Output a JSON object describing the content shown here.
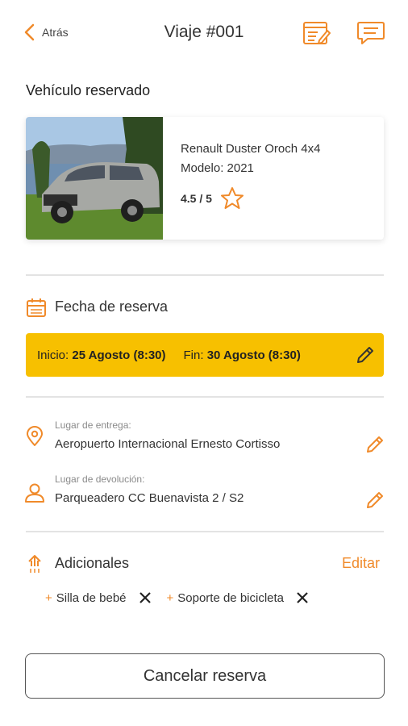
{
  "header": {
    "back_label": "Atrás",
    "title": "Viaje #001",
    "icons": [
      "notes-icon",
      "chat-icon"
    ]
  },
  "vehicle": {
    "section_title": "Vehículo reservado",
    "name": "Renault Duster Oroch 4x4",
    "model": "Modelo: 2021",
    "rating": "4.5 / 5"
  },
  "booking_dates": {
    "title": "Fecha de reserva",
    "start_label": "Inicio:",
    "start_value": "25 Agosto (8:30)",
    "end_label": "Fin:",
    "end_value": "30 Agosto (8:30)"
  },
  "pickup": {
    "label": "Lugar de entrega:",
    "value": "Aeropuerto Internacional Ernesto Cortisso"
  },
  "dropoff": {
    "label": "Lugar de devolución:",
    "value": "Parqueadero CC Buenavista 2 / S2"
  },
  "additionals": {
    "title": "Adicionales",
    "edit_label": "Editar",
    "items": [
      "Silla de bebé",
      "Soporte de bicicleta"
    ]
  },
  "cancel_label": "Cancelar reserva",
  "colors": {
    "accent": "#f08a2a",
    "date_bar": "#f7c000"
  }
}
